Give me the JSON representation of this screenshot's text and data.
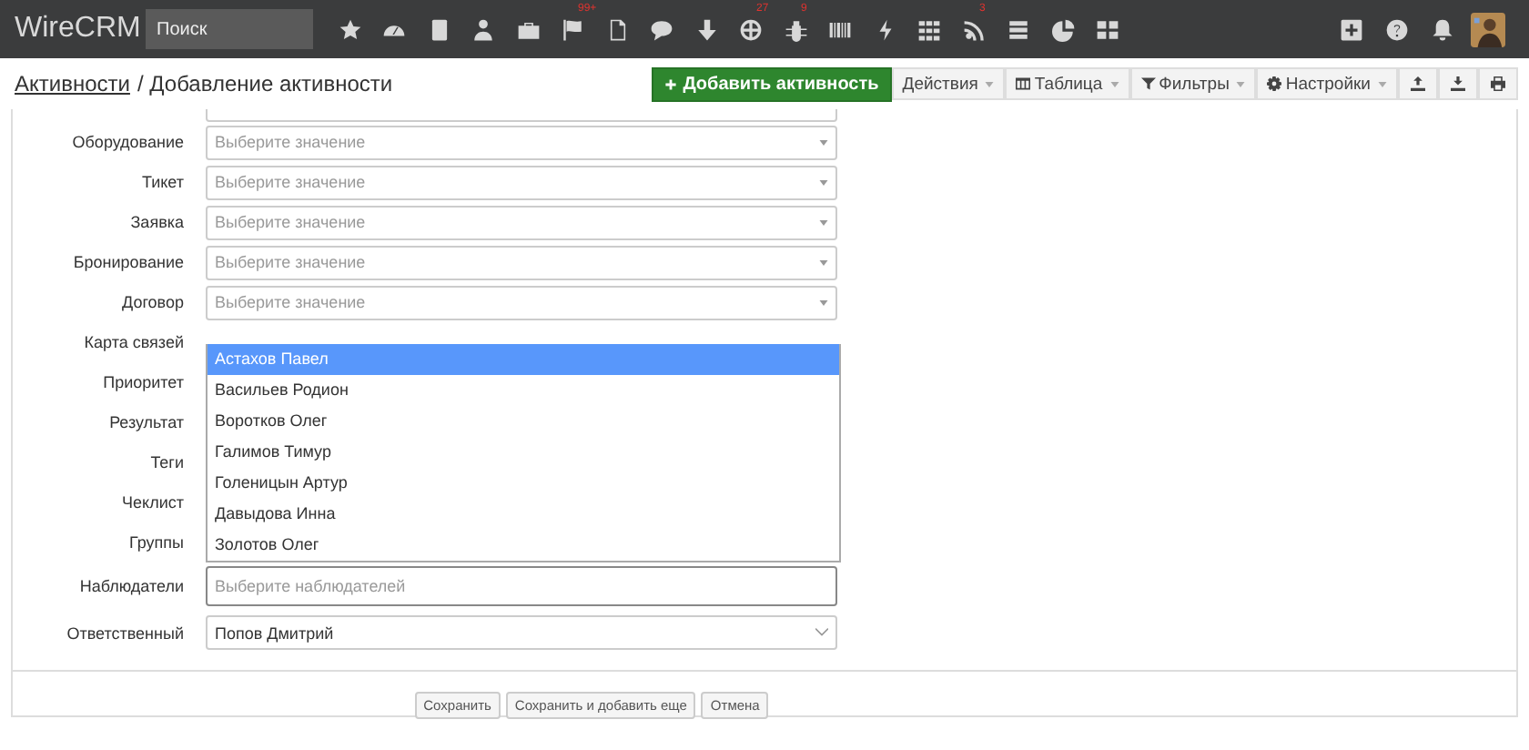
{
  "navbar": {
    "logo": "WireCRM",
    "search": {
      "placeholder": "Поиск"
    },
    "icons": [
      {
        "kind": "star"
      },
      {
        "kind": "gauge"
      },
      {
        "kind": "document"
      },
      {
        "kind": "user"
      },
      {
        "kind": "briefcase"
      },
      {
        "kind": "flag",
        "badge": "99+"
      },
      {
        "kind": "file"
      },
      {
        "kind": "chat"
      },
      {
        "kind": "arrow-down"
      },
      {
        "kind": "globe",
        "badge": "27"
      },
      {
        "kind": "bug",
        "badge": "9"
      },
      {
        "kind": "barcode"
      },
      {
        "kind": "bolt"
      },
      {
        "kind": "grid"
      },
      {
        "kind": "rss",
        "badge": "3"
      },
      {
        "kind": "database"
      },
      {
        "kind": "pie"
      },
      {
        "kind": "tiles"
      }
    ],
    "right_icons": [
      {
        "kind": "plus"
      },
      {
        "kind": "question"
      },
      {
        "kind": "bell"
      },
      {
        "kind": "avatar"
      }
    ]
  },
  "header": {
    "breadcrumb_link": "Активности",
    "title": "/ Добавление активности"
  },
  "toolbar": {
    "primary": "Добавить активность",
    "menus": [
      {
        "label": "Действия"
      },
      {
        "label": "Таблица"
      },
      {
        "label": "Фильтры"
      },
      {
        "label": "Настройки"
      }
    ],
    "icon_buttons": [
      {
        "kind": "upload"
      },
      {
        "kind": "download"
      },
      {
        "kind": "print"
      }
    ]
  },
  "form": {
    "fields": [
      {
        "label": "Оборудование",
        "kind": "select",
        "placeholder": "Выберите значение"
      },
      {
        "label": "Тикет",
        "kind": "select",
        "placeholder": "Выберите значение"
      },
      {
        "label": "Заявка",
        "kind": "select",
        "placeholder": "Выберите значение"
      },
      {
        "label": "Бронирование",
        "kind": "select",
        "placeholder": "Выберите значение"
      },
      {
        "label": "Договор",
        "kind": "select",
        "placeholder": "Выберите значение"
      },
      {
        "label": "Карта связей",
        "kind": "covered"
      },
      {
        "label": "Приоритет",
        "kind": "covered"
      },
      {
        "label": "Результат",
        "kind": "covered"
      },
      {
        "label": "Теги",
        "kind": "covered"
      },
      {
        "label": "Чеклист",
        "kind": "covered"
      },
      {
        "label": "Группы",
        "kind": "covered"
      },
      {
        "label": "Наблюдатели",
        "kind": "multi",
        "placeholder": "Выберите наблюдателей"
      },
      {
        "label": "Ответственный",
        "kind": "value",
        "value": "Попов Дмитрий"
      }
    ],
    "dropdown": [
      {
        "label": "Астахов Павел",
        "selected": true
      },
      {
        "label": "Васильев Родион",
        "selected": false
      },
      {
        "label": "Воротков Олег",
        "selected": false
      },
      {
        "label": "Галимов Тимур",
        "selected": false
      },
      {
        "label": "Голеницын Артур",
        "selected": false
      },
      {
        "label": "Давыдова Инна",
        "selected": false
      },
      {
        "label": "Золотов Олег",
        "selected": false
      }
    ],
    "buttons": [
      "Сохранить",
      "Сохранить и добавить еще",
      "Отмена"
    ]
  }
}
